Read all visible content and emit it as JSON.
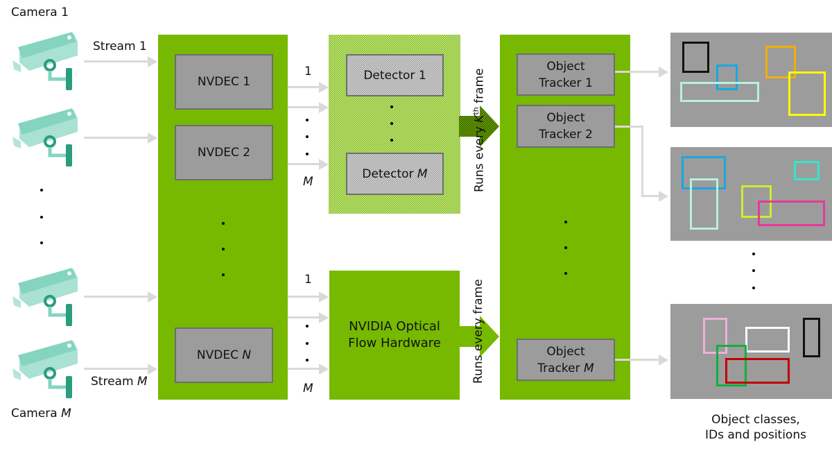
{
  "cameras": {
    "top_label": "Camera 1",
    "bottom_label_prefix": "Camera ",
    "bottom_label_var": "M",
    "icon": "security-camera-icon",
    "color_light": "#84d4c0",
    "color_dark": "#2a9d7e"
  },
  "streams": {
    "first": "Stream 1",
    "last_prefix": "Stream ",
    "last_var": "M"
  },
  "decoders": {
    "items": [
      "NVDEC 1",
      "NVDEC 2"
    ],
    "last_prefix": "NVDEC ",
    "last_var": "N"
  },
  "detector_inputs": {
    "first": "1",
    "last": "M"
  },
  "detectors": {
    "first": "Detector 1",
    "last_prefix": "Detector ",
    "last_var": "M"
  },
  "optical_flow": {
    "input_first": "1",
    "input_last": "M",
    "title_line1": "NVIDIA Optical",
    "title_line2": "Flow Hardware"
  },
  "schedule": {
    "detector_prefix": "Runs every ",
    "detector_var": "K",
    "detector_sup": "th",
    "detector_suffix": " frame",
    "optical_flow": "Runs every frame"
  },
  "trackers": {
    "t1_line1": "Object",
    "t1_line2": "Tracker 1",
    "t2_line1": "Object",
    "t2_line2": "Tracker 2",
    "tm_line1": "Object",
    "tm_line2_prefix": "Tracker ",
    "tm_line2_var": "M"
  },
  "output": {
    "caption_line1": "Object classes,",
    "caption_line2": "IDs and positions",
    "box_colors": {
      "black": "#111111",
      "blue": "#1aa7e0",
      "aqua": "#b8f0e0",
      "orange": "#f0b000",
      "yellow": "#ffff00",
      "teal": "#30e8c8",
      "lime": "#c8f030",
      "magenta": "#e83898",
      "pink": "#f0b0d8",
      "white": "#ffffff",
      "green": "#10b040",
      "red": "#c00000"
    }
  },
  "colors": {
    "nvidia_green": "#76b900",
    "box_gray": "#9c9c9c",
    "arrow_gray": "#d9d9d9"
  }
}
